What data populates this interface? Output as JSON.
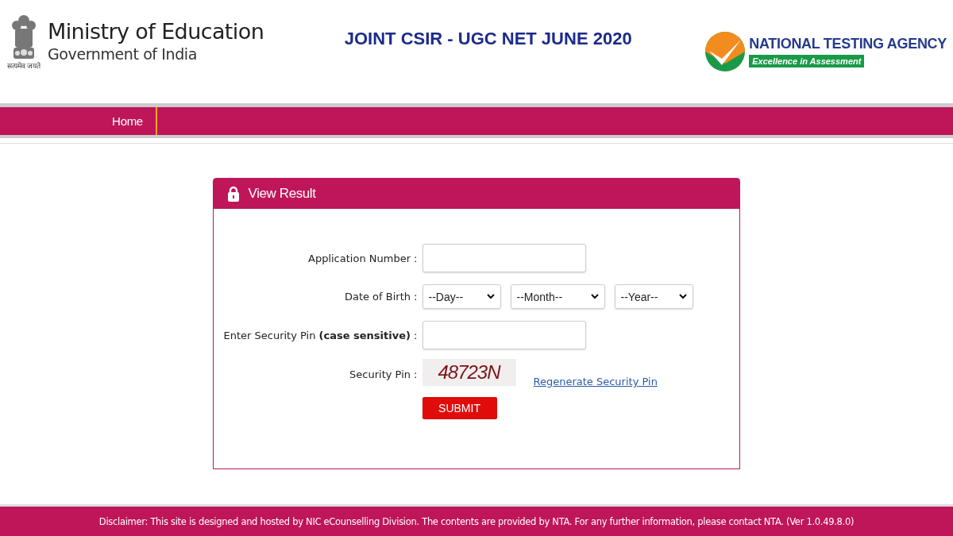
{
  "header": {
    "ministry": {
      "motto": "सत्यमेव जयते",
      "title": "Ministry of Education",
      "subtitle": "Government of India"
    },
    "exam_title": "JOINT CSIR - UGC NET JUNE 2020",
    "agency": {
      "name": "NATIONAL TESTING AGENCY",
      "tagline": "Excellence in Assessment"
    }
  },
  "nav": {
    "items": [
      {
        "label": "Home"
      }
    ]
  },
  "form": {
    "title": "View Result",
    "rows": [
      {
        "kind": "text",
        "label": "Application Number :"
      },
      {
        "kind": "selects",
        "label": "Date of Birth :",
        "selects": [
          "--Day--",
          "--Month--",
          "--Year--"
        ]
      },
      {
        "kind": "text",
        "label": "Enter Security Pin **(case sensitive)** :"
      },
      {
        "kind": "captcha",
        "label": "Security Pin :",
        "captcha": "48723N",
        "link": "Regenerate Security Pin"
      }
    ],
    "submit": "SUBMIT"
  },
  "footer": {
    "disclaimer": "Disclaimer: This site is designed and hosted by NIC eCounselling Division. The contents are provided by NTA. For any further information, please contact NTA. (Ver 1.0.49.8.0)"
  }
}
